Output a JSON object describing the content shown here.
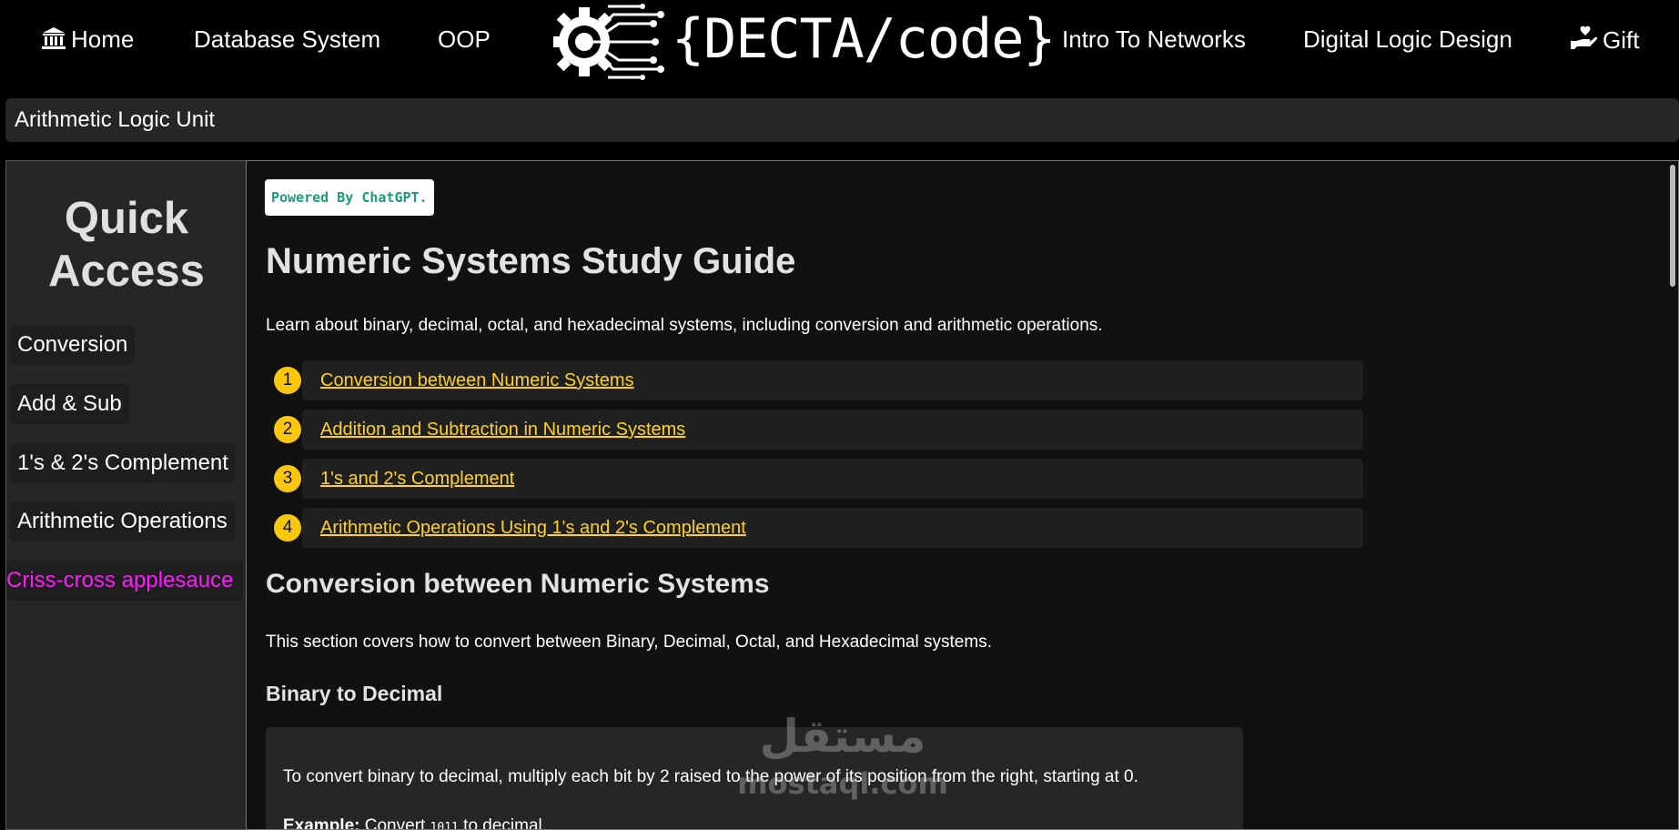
{
  "nav": {
    "home": "Home",
    "database": "Database System",
    "oop": "OOP",
    "logo_text": "{DECTA/code}",
    "networks": "Intro To Networks",
    "digital_logic": "Digital Logic Design",
    "gift": "Gift"
  },
  "breadcrumb": "Arithmetic Logic Unit",
  "sidebar": {
    "title_line1": "Quick",
    "title_line2": "Access",
    "items": [
      {
        "label": "Conversion"
      },
      {
        "label": "Add & Sub"
      },
      {
        "label": "1's & 2's Complement"
      },
      {
        "label": "Arithmetic Operations"
      },
      {
        "label": "Criss-cross applesauce"
      }
    ]
  },
  "main": {
    "powered": "Powered By ChatGPT.",
    "title": "Numeric Systems Study Guide",
    "intro": "Learn about binary, decimal, octal, and hexadecimal systems, including conversion and arithmetic operations.",
    "toc": [
      {
        "num": "1",
        "label": "Conversion between Numeric Systems"
      },
      {
        "num": "2",
        "label": "Addition and Subtraction in Numeric Systems"
      },
      {
        "num": "3",
        "label": "1's and 2's Complement"
      },
      {
        "num": "4",
        "label": "Arithmetic Operations Using 1's and 2's Complement"
      }
    ],
    "section_title": "Conversion between Numeric Systems",
    "section_intro": "This section covers how to convert between Binary, Decimal, Octal, and Hexadecimal systems.",
    "subsection_title": "Binary to Decimal",
    "card_text": "To convert binary to decimal, multiply each bit by 2 raised to the power of its position from the right, starting at 0.",
    "example_label": "Example:",
    "example_text_before": "Convert",
    "example_code": "1011",
    "example_text_after": "to decimal"
  },
  "watermark": {
    "arabic": "مستقل",
    "latin": "mostaql.com"
  },
  "colors": {
    "accent_yellow": "#ffd21f",
    "badge_yellow": "#f9c80e",
    "highlight_pink": "#ff19ff",
    "powered_green": "#1a9b7a"
  }
}
